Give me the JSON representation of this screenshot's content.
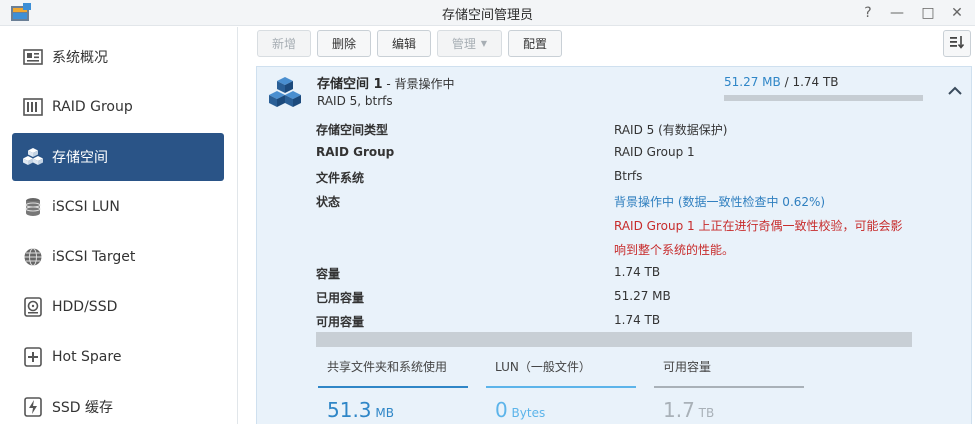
{
  "window": {
    "title": "存储空间管理员",
    "help": "?",
    "minimize": "—",
    "maximize": "□",
    "close": "✕"
  },
  "sidebar": {
    "items": [
      {
        "label": "系统概况",
        "icon": "overview-icon"
      },
      {
        "label": "RAID Group",
        "icon": "raid-icon"
      },
      {
        "label": "存储空间",
        "icon": "volume-cubes-icon",
        "active": true
      },
      {
        "label": "iSCSI LUN",
        "icon": "database-icon"
      },
      {
        "label": "iSCSI Target",
        "icon": "globe-icon"
      },
      {
        "label": "HDD/SSD",
        "icon": "disk-icon"
      },
      {
        "label": "Hot Spare",
        "icon": "hot-spare-icon"
      },
      {
        "label": "SSD 缓存",
        "icon": "ssd-cache-icon"
      }
    ]
  },
  "toolbar": {
    "create": "新增",
    "delete": "删除",
    "edit": "编辑",
    "manage": "管理",
    "configure": "配置"
  },
  "volume": {
    "name": "存储空间 1",
    "status_suffix": " - 背景操作中",
    "subtitle": "RAID 5, btrfs",
    "used": "51.27 MB",
    "separator": " / ",
    "total": "1.74 TB",
    "usage_fraction": 0.0,
    "details": [
      {
        "label": "存储空间类型",
        "value": "RAID 5 (有数据保护)"
      },
      {
        "label": "RAID Group",
        "value": "RAID Group 1"
      },
      {
        "label": "文件系统",
        "value": "Btrfs"
      },
      {
        "label": "状态",
        "value": "背景操作中 (数据一致性检查中 0.62%)"
      }
    ],
    "warning_line1": "RAID Group 1 上正在进行奇偶一致性校验，可能会影",
    "warning_line2": "响到整个系统的性能。",
    "capacity_rows": [
      {
        "label": "容量",
        "value": "1.74 TB"
      },
      {
        "label": "已用容量",
        "value": "51.27 MB"
      },
      {
        "label": "可用容量",
        "value": "1.74 TB"
      }
    ],
    "legend": [
      {
        "title": "共享文件夹和系统使用",
        "number": "51.3",
        "unit": " MB",
        "color": "#2f86c7"
      },
      {
        "title": "LUN（一般文件）",
        "number": "0",
        "unit": " Bytes",
        "color": "#5cb4ea"
      },
      {
        "title": "可用容量",
        "number": "1.7",
        "unit": " TB",
        "color": "#a9b1b8"
      }
    ]
  },
  "colors": {
    "accent": "#2a5487",
    "usage_blue": "#2f86c7",
    "warning_red": "#c72b2b",
    "panel_bg": "#e9f2fa"
  }
}
